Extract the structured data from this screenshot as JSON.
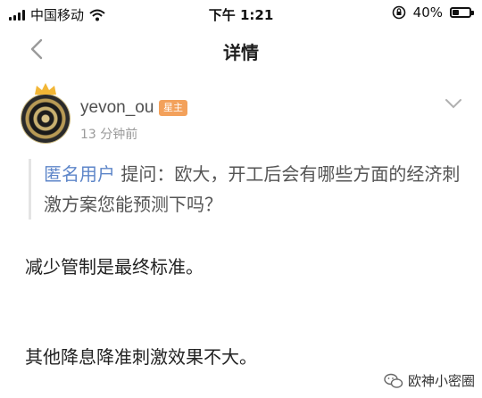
{
  "status": {
    "carrier": "中国移动",
    "time": "下午 1:21",
    "battery_text": "40%",
    "battery_level": 0.4
  },
  "nav": {
    "title": "详情",
    "back_icon": "chevron-left-icon"
  },
  "post": {
    "username": "yevon_ou",
    "badge": "星主",
    "time": "13 分钟前",
    "more_icon": "chevron-down-icon"
  },
  "question": {
    "asker": "匿名用户",
    "text": " 提问：欧大，开工后会有哪些方面的经济刺激方案您能预测下吗？"
  },
  "answers": [
    "减少管制是最终标准。",
    "其他降息降准刺激效果不大。"
  ],
  "watermark": {
    "text": "欧神小密圈"
  },
  "colors": {
    "accent_blue": "#5e86c9",
    "badge_orange": "#f3a15b"
  }
}
